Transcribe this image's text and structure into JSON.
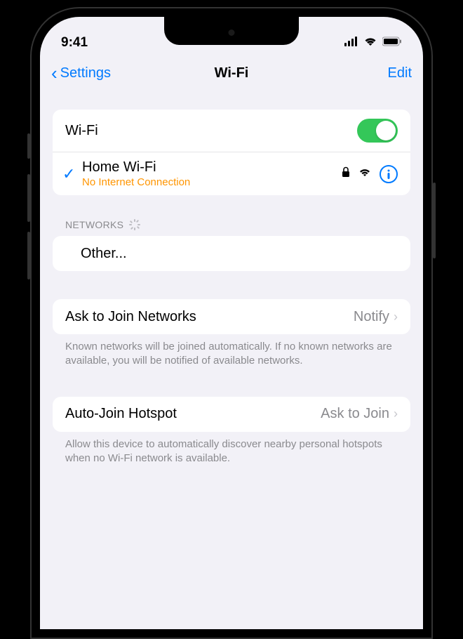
{
  "status_bar": {
    "time": "9:41"
  },
  "nav": {
    "back_label": "Settings",
    "title": "Wi-Fi",
    "edit_label": "Edit"
  },
  "wifi": {
    "toggle_label": "Wi-Fi",
    "toggle_on": true,
    "connected": {
      "name": "Home Wi-Fi",
      "status": "No Internet Connection"
    }
  },
  "networks": {
    "header": "NETWORKS",
    "other_label": "Other..."
  },
  "ask_join": {
    "label": "Ask to Join Networks",
    "value": "Notify",
    "footer": "Known networks will be joined automatically. If no known networks are available, you will be notified of available networks."
  },
  "auto_hotspot": {
    "label": "Auto-Join Hotspot",
    "value": "Ask to Join",
    "footer": "Allow this device to automatically discover nearby personal hotspots when no Wi-Fi network is available."
  }
}
